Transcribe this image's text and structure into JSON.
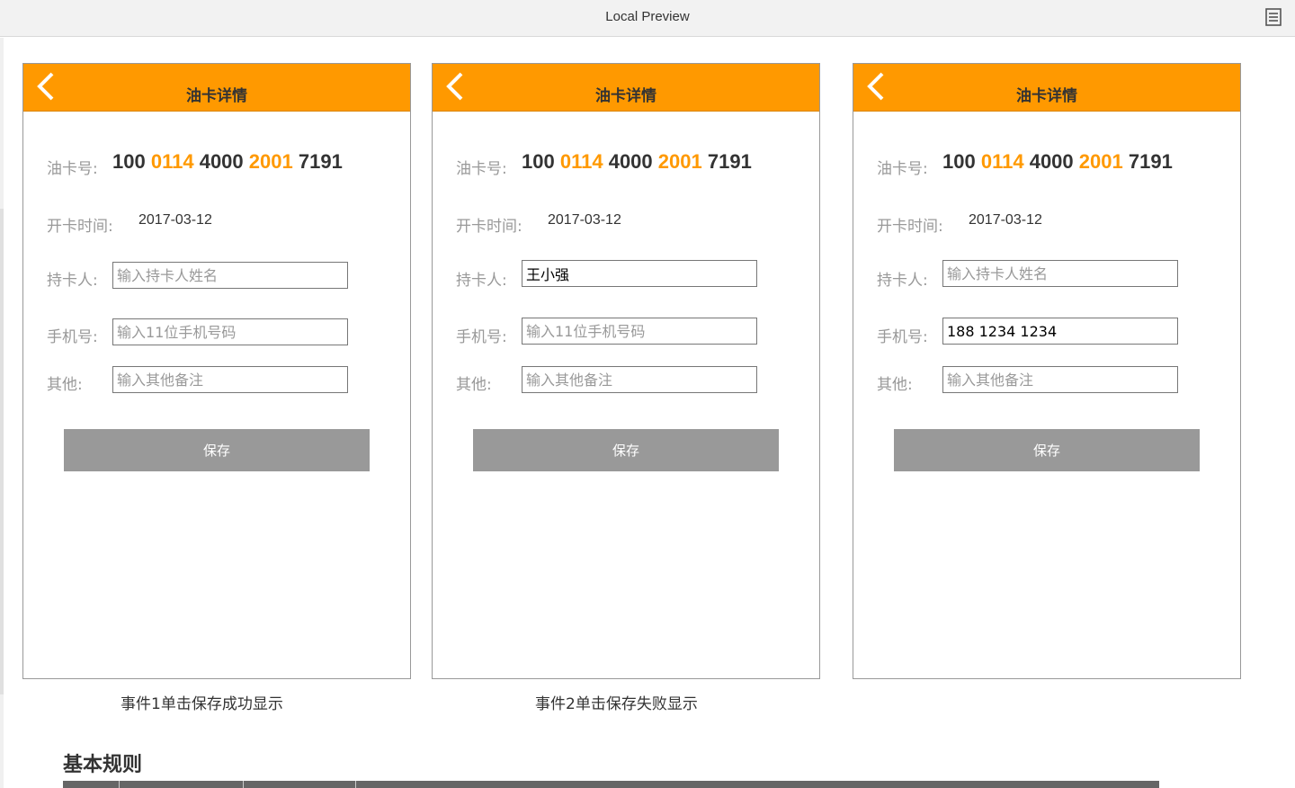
{
  "window": {
    "title": "Local Preview",
    "menu_icon": "list-icon"
  },
  "phones": [
    {
      "header_title": "油卡详情",
      "card_label": "油卡号:",
      "card_parts": [
        "100",
        "0114",
        "4000",
        "2001",
        "7191"
      ],
      "open_label": "开卡时间:",
      "open_date": "2017-03-12",
      "holder_label": "持卡人:",
      "holder_value": "",
      "holder_placeholder": "输入持卡人姓名",
      "phone_label": "手机号:",
      "phone_value": "",
      "phone_placeholder": "输入11位手机号码",
      "other_label": "其他:",
      "other_value": "",
      "other_placeholder": "输入其他备注",
      "save_label": "保存"
    },
    {
      "header_title": "油卡详情",
      "card_label": "油卡号:",
      "card_parts": [
        "100",
        "0114",
        "4000",
        "2001",
        "7191"
      ],
      "open_label": "开卡时间:",
      "open_date": "2017-03-12",
      "holder_label": "持卡人:",
      "holder_value": "王小强",
      "holder_placeholder": "",
      "phone_label": "手机号:",
      "phone_value": "",
      "phone_placeholder": "输入11位手机号码",
      "other_label": "其他:",
      "other_value": "",
      "other_placeholder": "输入其他备注",
      "save_label": "保存"
    },
    {
      "header_title": "油卡详情",
      "card_label": "油卡号:",
      "card_parts": [
        "100",
        "0114",
        "4000",
        "2001",
        "7191"
      ],
      "open_label": "开卡时间:",
      "open_date": "2017-03-12",
      "holder_label": "持卡人:",
      "holder_value": "",
      "holder_placeholder": "输入持卡人姓名",
      "phone_label": "手机号:",
      "phone_value": "188 1234 1234",
      "phone_placeholder": "",
      "other_label": "其他:",
      "other_value": "",
      "other_placeholder": "输入其他备注",
      "save_label": "保存"
    }
  ],
  "captions": [
    "事件1单击保存成功显示",
    "事件2单击保存失败显示"
  ],
  "section_title": "基本规则",
  "colors": {
    "accent": "#ff9900",
    "button": "#999999",
    "header_text": "#333333"
  }
}
